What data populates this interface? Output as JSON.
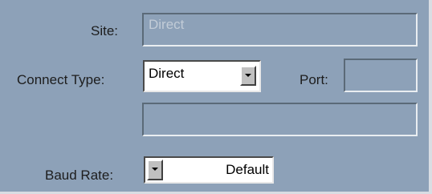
{
  "labels": {
    "site": "Site:",
    "connect_type": "Connect Type:",
    "port": "Port:",
    "baud_rate": "Baud Rate:"
  },
  "fields": {
    "site_value": "Direct",
    "connect_type_value": "Direct",
    "port_value": "",
    "extra_value": "",
    "baud_rate_value": "Default"
  },
  "icons": {
    "dropdown": "chevron-down-icon"
  },
  "colors": {
    "panel_bg": "#8da1b8",
    "select_bg": "#ffffff",
    "disabled_text": "#c2ccd7"
  }
}
